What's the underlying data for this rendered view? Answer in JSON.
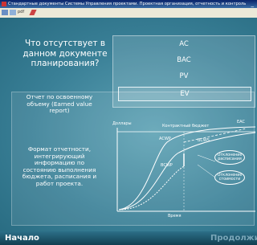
{
  "window": {
    "title": "Стандартные документы Системы Управления проектами. Проектная организация, отчетность и контроль",
    "minimize_glyph": "_"
  },
  "toolbar": {
    "pdf_label": "pdf"
  },
  "question": "Что отсутствует в данном документе планирования?",
  "answers": [
    "AC",
    "BAC",
    "PV",
    "EV"
  ],
  "selected_answer": "EV",
  "info": {
    "term": "Отчет по освоенному объему (Earned value report)",
    "description": "Формат отчетности, интегрирующий информацию по состоянию выполнения бюджета, расписания и работ проекта."
  },
  "chart_labels": {
    "y_axis": "Доллары",
    "x_axis": "Время",
    "budget": "Контрактный бюджет",
    "eac": "EAC",
    "acwp": "ACWP",
    "bcws": "BCWS",
    "bcwp": "BCWP",
    "schedule_variance": "Отклонение расписания",
    "cost_variance": "Отклонение стоимости"
  },
  "bottom": {
    "start": "Начало",
    "next": "Продолжи"
  },
  "colors": {
    "background": "#3a8097",
    "titlebar": "#0a246a",
    "line": "#ffffff"
  }
}
